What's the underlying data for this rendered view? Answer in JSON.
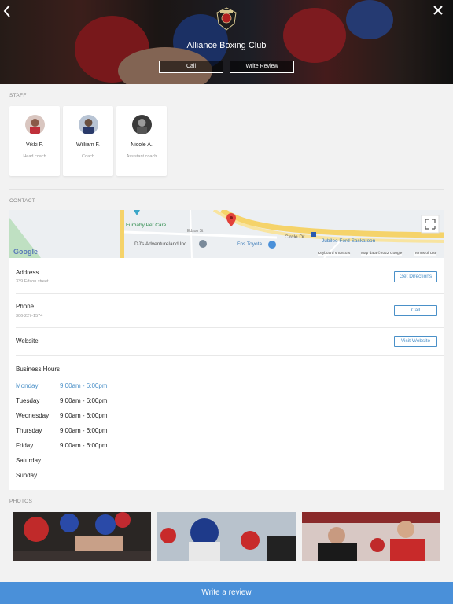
{
  "header": {
    "club_name": "Alliance Boxing Club",
    "call_label": "Call",
    "review_label": "Write Review",
    "back_icon": "chevron-left-icon",
    "close_icon": "close-icon"
  },
  "staff": {
    "section_label": "STAFF",
    "members": [
      {
        "name": "Vikki F.",
        "role": "Head coach"
      },
      {
        "name": "William F.",
        "role": "Coach"
      },
      {
        "name": "Nicole A.",
        "role": "Assistant coach"
      }
    ]
  },
  "contact": {
    "section_label": "CONTACT",
    "map": {
      "labels": {
        "furbaby": "Furbaby Pet Care",
        "dj": "DJ's Adventureland Inc",
        "ens": "Ens Toyota",
        "circle": "Circle Dr",
        "jubilee": "Jubilee Ford Saskatoon",
        "edson": "Edson St",
        "google": "Google",
        "shortcuts": "Keyboard shortcuts",
        "mapdata": "Map data ©2022 Google",
        "terms": "Terms of Use"
      }
    },
    "address": {
      "label": "Address",
      "value": "339 Edson street",
      "button": "Get Directions"
    },
    "phone": {
      "label": "Phone",
      "value": "306-227-1574",
      "button": "Call"
    },
    "website": {
      "label": "Website",
      "button": "Visit Website"
    },
    "hours": {
      "title": "Business Hours",
      "days": [
        {
          "day": "Monday",
          "time": "9:00am - 6:00pm"
        },
        {
          "day": "Tuesday",
          "time": "9:00am - 6:00pm"
        },
        {
          "day": "Wednesday",
          "time": "9:00am - 6:00pm"
        },
        {
          "day": "Thursday",
          "time": "9:00am - 6:00pm"
        },
        {
          "day": "Friday",
          "time": "9:00am - 6:00pm"
        },
        {
          "day": "Saturday",
          "time": ""
        },
        {
          "day": "Sunday",
          "time": ""
        }
      ]
    }
  },
  "photos": {
    "section_label": "PHOTOS"
  },
  "footer": {
    "cta_label": "Write a review"
  },
  "colors": {
    "accent": "#4a90d9",
    "link": "#4a90c8"
  }
}
